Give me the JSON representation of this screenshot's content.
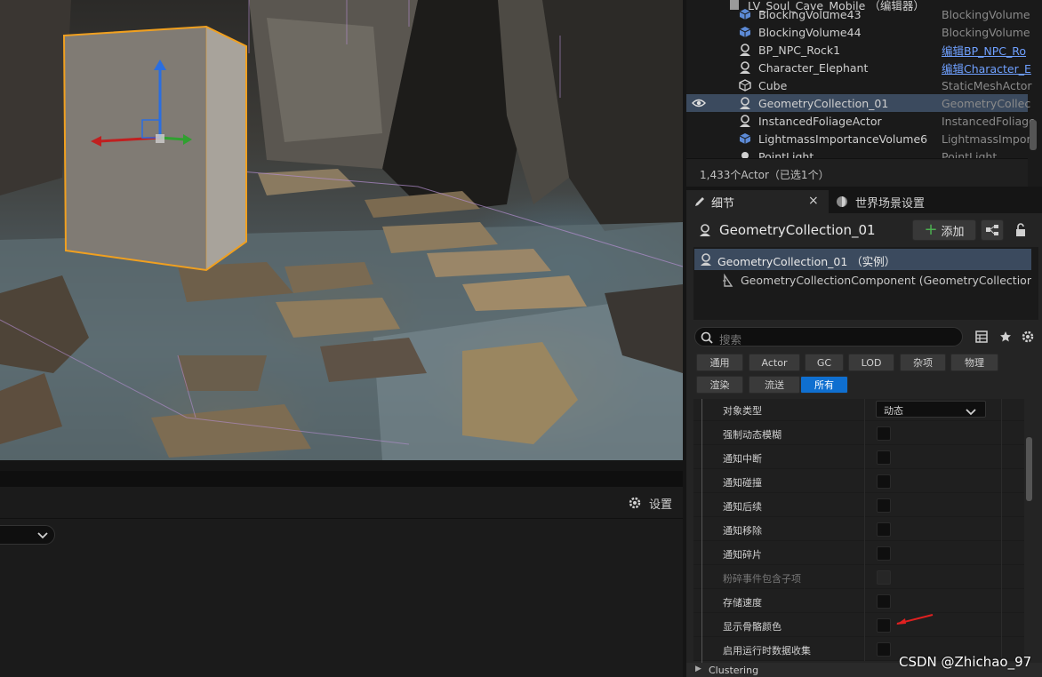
{
  "outliner": {
    "rows": [
      {
        "name": "LV_Soul_Cave_Mobile （编辑器）",
        "type": "",
        "icon": "level-icon"
      },
      {
        "name": "BlockingVolume43",
        "type": "BlockingVolume",
        "icon": "volume-icon"
      },
      {
        "name": "BlockingVolume44",
        "type": "BlockingVolume",
        "icon": "volume-icon"
      },
      {
        "name": "BP_NPC_Rock1",
        "type": "编辑BP_NPC_Ro",
        "icon": "actor-icon",
        "link": true
      },
      {
        "name": "Character_Elephant",
        "type": "编辑Character_E",
        "icon": "actor-icon",
        "link": true
      },
      {
        "name": "Cube",
        "type": "StaticMeshActor",
        "icon": "cube-icon"
      },
      {
        "name": "GeometryCollection_01",
        "type": "GeometryCollec",
        "icon": "actor-icon",
        "selected": true
      },
      {
        "name": "InstancedFoliageActor",
        "type": "InstancedFoliage",
        "icon": "actor-icon"
      },
      {
        "name": "LightmassImportanceVolume6",
        "type": "LightmassImpor",
        "icon": "volume-icon"
      },
      {
        "name": "PointLight",
        "type": "PointLight",
        "icon": "light-icon"
      }
    ],
    "status": "1,433个Actor（已选1个）"
  },
  "details": {
    "tab_details": "细节",
    "tab_world": "世界场景设置",
    "actor_name": "GeometryCollection_01",
    "add_label": "添加",
    "instance_label": "GeometryCollection_01 （实例）",
    "component_label": "GeometryCollectionComponent (GeometryCollectionComp",
    "search_placeholder": "搜索",
    "categories_row1": [
      "通用",
      "Actor",
      "GC",
      "LOD",
      "杂项",
      "物理"
    ],
    "categories_row2": [
      "渲染",
      "流送",
      "所有"
    ],
    "active_category": "所有",
    "props": [
      {
        "label": "对象类型",
        "kind": "dropdown",
        "value": "动态"
      },
      {
        "label": "强制动态模糊",
        "kind": "checkbox"
      },
      {
        "label": "通知中断",
        "kind": "checkbox"
      },
      {
        "label": "通知碰撞",
        "kind": "checkbox"
      },
      {
        "label": "通知后续",
        "kind": "checkbox"
      },
      {
        "label": "通知移除",
        "kind": "checkbox"
      },
      {
        "label": "通知碎片",
        "kind": "checkbox"
      },
      {
        "label": "粉碎事件包含子项",
        "kind": "checkbox",
        "disabled": true
      },
      {
        "label": "存储速度",
        "kind": "checkbox"
      },
      {
        "label": "显示骨骼颜色",
        "kind": "checkbox"
      },
      {
        "label": "启用运行时数据收集",
        "kind": "checkbox"
      }
    ],
    "section": "Clustering"
  },
  "bottom": {
    "settings_label": "设置"
  },
  "watermark": "CSDN @Zhichao_97",
  "colors": {
    "selection": "#3b4a5e",
    "active_button": "#0f6fd0",
    "gizmo_outline": "#f0a020",
    "annotation_arrow": "#e02020"
  }
}
